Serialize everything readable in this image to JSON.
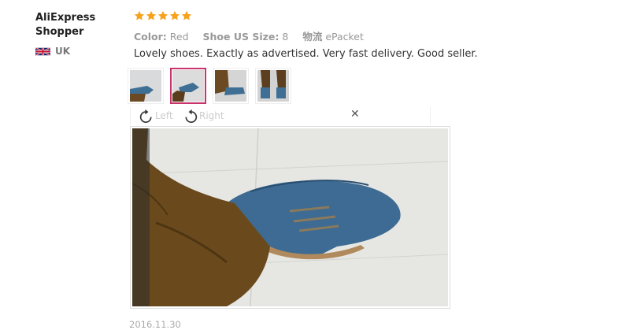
{
  "reviewer": {
    "name": "AliExpress Shopper",
    "country": "UK",
    "flag_icon": "uk-flag-icon"
  },
  "rating": {
    "stars": 5,
    "max": 5,
    "color": "#f7a21c"
  },
  "attributes": [
    {
      "key": "Color:",
      "value": "Red"
    },
    {
      "key": "Shoe US Size:",
      "value": "8"
    },
    {
      "key": "物流",
      "value": "ePacket"
    }
  ],
  "review_text": "Lovely shoes. Exactly as advertised. Very fast delivery. Good seller.",
  "thumbnails": {
    "count": 4,
    "active_index": 1,
    "active_border_color": "#c8336a"
  },
  "viewer": {
    "rotate_left_label": "Left",
    "rotate_right_label": "Right",
    "close_label": "✕"
  },
  "date": "2016.11.30"
}
